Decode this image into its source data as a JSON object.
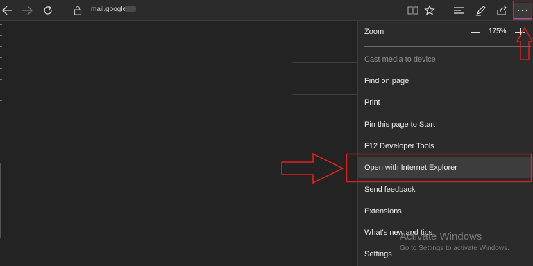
{
  "browser": {
    "address_text": "mail.google",
    "icons": [
      "back-icon",
      "forward-icon",
      "refresh-icon",
      "lock-icon",
      "reading-view-icon",
      "favorite-star-icon",
      "hub-icon",
      "web-note-icon",
      "share-icon",
      "more-icon"
    ]
  },
  "menu": {
    "zoom": {
      "label": "Zoom",
      "value": "175%"
    },
    "items": [
      {
        "label": "Cast media to device",
        "disabled": true
      },
      {
        "label": "Find on page"
      },
      {
        "label": "Print"
      },
      {
        "label": "Pin this page to Start"
      },
      {
        "label": "F12 Developer Tools"
      },
      {
        "label": "Open with Internet Explorer",
        "highlighted": true
      },
      {
        "label": "Send feedback"
      },
      {
        "label": "Extensions"
      },
      {
        "label": "What's new and tips"
      },
      {
        "label": "Settings"
      }
    ]
  },
  "annotations": {
    "color": "#e02020"
  },
  "watermark": {
    "title": "Activate Windows",
    "subtitle": "Go to Settings to activate Windows."
  }
}
